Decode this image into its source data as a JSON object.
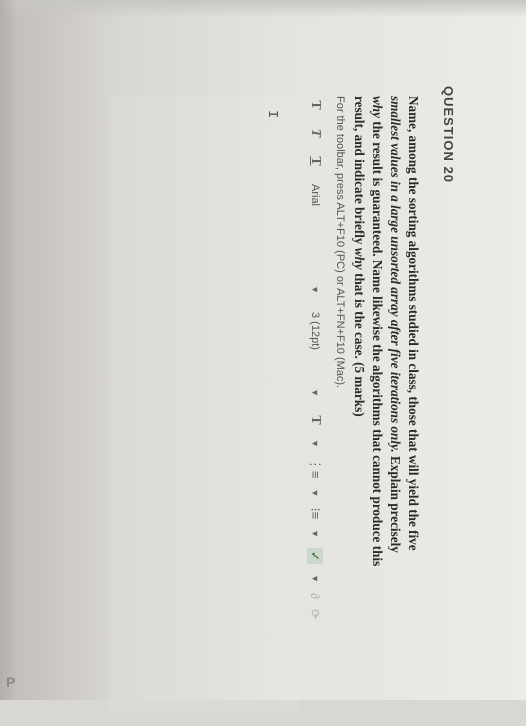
{
  "question": {
    "header": "QUESTION 20",
    "text_lines": [
      {
        "parts": [
          {
            "text": "Name, among the sorting algorithms studied in class, those that will yield the five",
            "style": "bold"
          }
        ]
      },
      {
        "parts": [
          {
            "text": "smallest values in a large unsorted array after five iterations only.",
            "style": "bold-italic"
          },
          {
            "text": " Explain precisely",
            "style": "bold"
          }
        ]
      },
      {
        "parts": [
          {
            "text": "why",
            "style": "bold-italic"
          },
          {
            "text": " the result is guaranteed. Name likewise the algorithms that cannot produce this",
            "style": "bold"
          }
        ]
      },
      {
        "parts": [
          {
            "text": "result, and indicate briefly ",
            "style": "bold"
          },
          {
            "text": "why",
            "style": "bold-italic"
          },
          {
            "text": " that is the case.  (5 marks)",
            "style": "bold"
          }
        ]
      }
    ]
  },
  "toolbar": {
    "hint": "For the toolbar, press ALT+F10 (PC) or ALT+FN+F10 (Mac).",
    "bold": "T",
    "italic": "T",
    "underline": "T",
    "font_value": "Arial",
    "size_value": "3 (12pt)",
    "text_color_label": "T",
    "list_bullets": "⋮≡",
    "list_numbers": "⁝≡",
    "spellcheck": "✓",
    "extra_1": "∂",
    "extra_2": "⟳"
  },
  "editor": {
    "cursor": "I"
  },
  "footer": {
    "p_mark": "P"
  }
}
